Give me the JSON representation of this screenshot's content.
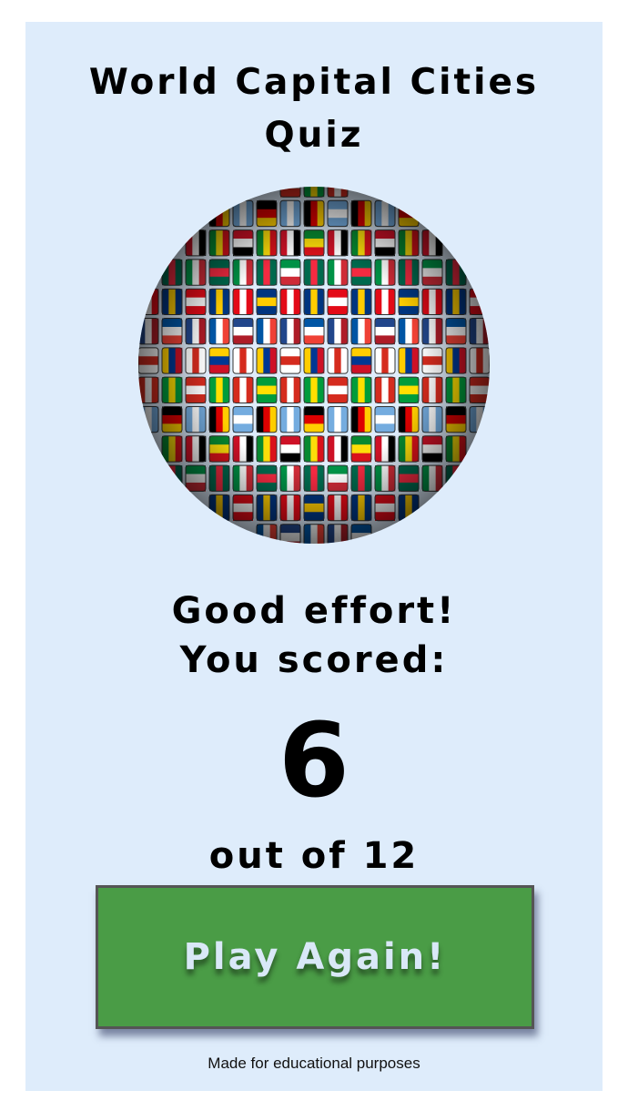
{
  "app": {
    "title_line1": "World Capital Cities",
    "title_line2": "Quiz"
  },
  "hero_image": {
    "icon": "flag-globe-icon",
    "description_alt": "Globe covered in world flags"
  },
  "result": {
    "message": "Good effort!",
    "score_label": "You scored:",
    "score": "6",
    "total_text": "out of 12"
  },
  "actions": {
    "play_again_label": "Play Again!"
  },
  "footer": {
    "note": "Made for educational purposes"
  },
  "colors": {
    "panel_bg": "#deecfb",
    "button_bg": "#4a9c46",
    "button_text": "#d9e8f7",
    "text": "#000000"
  }
}
